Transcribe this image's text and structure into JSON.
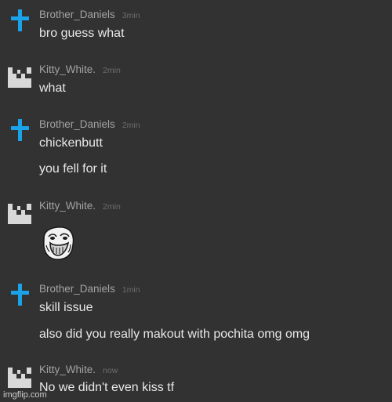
{
  "messages": [
    {
      "author": "Brother_Daniels",
      "avatar_icon": "blue-cross-icon",
      "time": "3min",
      "lines": [
        "bro guess what"
      ]
    },
    {
      "author": "Kitty_White.",
      "avatar_icon": "pixel-castle-icon",
      "time": "2min",
      "lines": [
        "what"
      ]
    },
    {
      "author": "Brother_Daniels",
      "avatar_icon": "blue-cross-icon",
      "time": "2min",
      "lines": [
        "chickenbutt",
        "you fell for it"
      ]
    },
    {
      "author": "Kitty_White.",
      "avatar_icon": "pixel-castle-icon",
      "time": "2min",
      "emoji": "troll-face-icon"
    },
    {
      "author": "Brother_Daniels",
      "avatar_icon": "blue-cross-icon",
      "time": "1min",
      "lines": [
        "skill issue",
        "also did you really makout with pochita omg omg"
      ]
    },
    {
      "author": "Kitty_White.",
      "avatar_icon": "pixel-castle-icon",
      "time": "now",
      "lines": [
        "No we didn't even kiss tf"
      ]
    }
  ],
  "watermark": "imgflip.com",
  "colors": {
    "background": "#323232",
    "cross_blue": "#1aa3e8",
    "castle_gray": "#d8d8d8",
    "username": "#a3a3a3",
    "timestamp": "#6d6d6d",
    "message_text": "#e8e8e8"
  }
}
